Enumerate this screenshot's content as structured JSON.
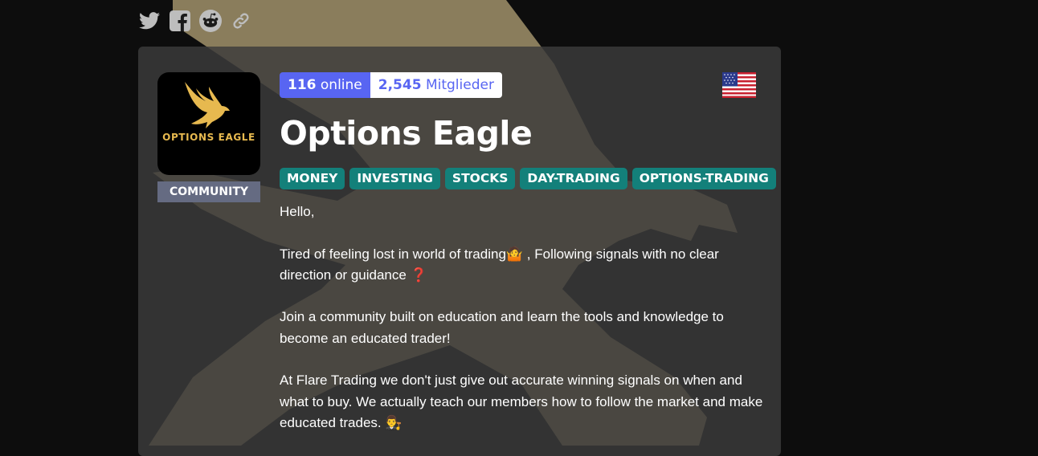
{
  "share": {
    "icons": [
      "twitter-icon",
      "facebook-icon",
      "reddit-icon",
      "link-icon"
    ]
  },
  "server": {
    "logo_text": "OPTIONS EAGLE",
    "category": "COMMUNITY",
    "online_count": "116",
    "online_label": "online",
    "members_count": "2,545",
    "members_label": "Mitglieder",
    "language_flag": "us-flag-icon",
    "name": "Options Eagle",
    "tags": [
      "MONEY",
      "INVESTING",
      "STOCKS",
      "DAY-TRADING",
      "OPTIONS-TRADING"
    ],
    "description": {
      "p1": "Hello,",
      "p2": "Tired of feeling lost in world of trading🤷 , Following signals with no clear direction or guidance ❓",
      "p3": "Join a community built on education and learn the tools and knowledge to become an educated trader!",
      "p4": "At Flare Trading we don't just give out accurate winning signals on when and what to buy. We actually teach our members how to follow the market and make educated trades. 👨‍⚖️"
    }
  },
  "colors": {
    "accent": "#5865f2",
    "tag": "#13807a",
    "community_badge": "#656b82",
    "logo_gold": "#e7b94f"
  }
}
